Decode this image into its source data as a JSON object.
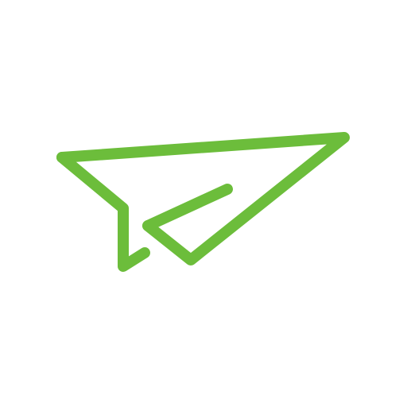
{
  "icon": {
    "name": "paper-plane-icon",
    "color": "#6cbd3b",
    "background": "#ffffff"
  }
}
